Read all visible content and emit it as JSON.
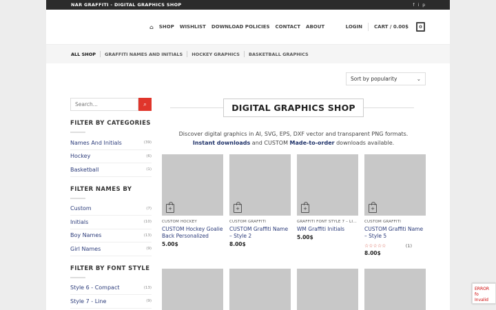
{
  "topbar": {
    "title": "NAR GRAFFITI - DIGITAL GRAPHICS SHOP",
    "social": [
      "f",
      "i",
      "p"
    ]
  },
  "nav": {
    "home_icon": "⌂",
    "items": [
      "SHOP",
      "WISHLIST",
      "DOWNLOAD POLICIES",
      "CONTACT",
      "ABOUT"
    ]
  },
  "account": {
    "login": "LOGIN",
    "cart": "CART / 0.00$",
    "cart_count": "0"
  },
  "catbar": [
    "ALL SHOP",
    "GRAFFITI NAMES AND INITIALS",
    "HOCKEY GRAPHICS",
    "BASKETBALL GRAPHICS"
  ],
  "sort": {
    "label": "Sort by popularity",
    "arrow": "⌄"
  },
  "search": {
    "placeholder": "Search...",
    "icon": "⌕"
  },
  "widgets": [
    {
      "title": "FILTER BY CATEGORIES",
      "items": [
        {
          "label": "Names And Initials",
          "count": "(39)"
        },
        {
          "label": "Hockey",
          "count": "(6)"
        },
        {
          "label": "Basketball",
          "count": "(1)"
        }
      ]
    },
    {
      "title": "FILTER NAMES BY",
      "items": [
        {
          "label": "Custom",
          "count": "(7)"
        },
        {
          "label": "Initials",
          "count": "(10)"
        },
        {
          "label": "Boy Names",
          "count": "(13)"
        },
        {
          "label": "Girl Names",
          "count": "(9)"
        }
      ]
    },
    {
      "title": "FILTER BY FONT STYLE",
      "items": [
        {
          "label": "Style 6 - Compact",
          "count": "(13)"
        },
        {
          "label": "Style 7 - Line",
          "count": "(9)"
        }
      ]
    }
  ],
  "heading": "DIGITAL GRAPHICS SHOP",
  "intro": {
    "line1": "Discover digital graphics in AI, SVG, EPS, DXF vector and transparent PNG formats.",
    "link1": "Instant downloads",
    "mid": " and CUSTOM ",
    "link2": "Made-to-order",
    "end": " downloads available."
  },
  "products": [
    {
      "category": "CUSTOM HOCKEY",
      "name": "CUSTOM Hockey Goalie Back Personalized",
      "price": "5.00$"
    },
    {
      "category": "CUSTOM GRAFFITI",
      "name": "CUSTOM Graffiti Name – Style 2",
      "price": "8.00$"
    },
    {
      "category": "GRAFFITI FONT STYLE 7 – LI...",
      "name": "WM Graffiti Initials",
      "price": "5.00$"
    },
    {
      "category": "CUSTOM GRAFFITI",
      "name": "CUSTOM Graffiti Name – Style 5",
      "price": "8.00$",
      "stars": "☆☆☆☆☆",
      "rating_count": "(1)"
    }
  ],
  "recaptcha": {
    "text": "ERROR fo Invalid do"
  },
  "colors": {
    "accent": "#e0352b",
    "link": "#2b3b7a",
    "topbar": "#2b2b2b"
  }
}
